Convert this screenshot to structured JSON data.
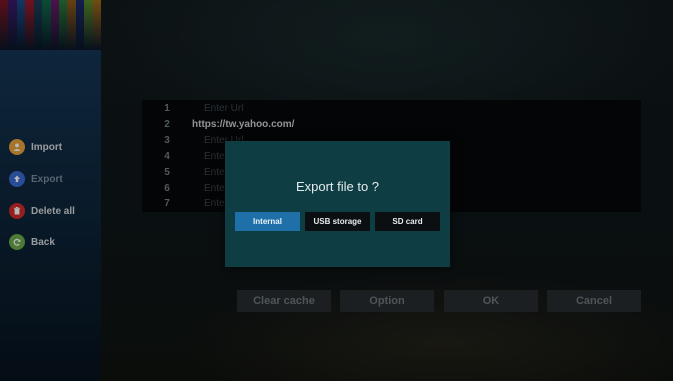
{
  "sidebar": {
    "stripe_colors": [
      "#7a1424",
      "#3a1a6a",
      "#1c4a8a",
      "#9a1a2a",
      "#1a3f5a",
      "#0f6a4a",
      "#6a1a6a",
      "#2a7a3a",
      "#8a5a1a",
      "#1a2a6a",
      "#5a8a2a",
      "#a06a1a"
    ],
    "items": [
      {
        "label": "Import",
        "icon": "person-icon",
        "icon_color": "#e8a23a"
      },
      {
        "label": "Export",
        "icon": "upload-arrow-icon",
        "icon_color": "#3a6ad0"
      },
      {
        "label": "Delete all",
        "icon": "trash-icon",
        "icon_color": "#d22a2a"
      },
      {
        "label": "Back",
        "icon": "back-arrow-icon",
        "icon_color": "#6aa84a"
      }
    ]
  },
  "url_list": {
    "rows": [
      {
        "num": "1",
        "text": "Enter Url"
      },
      {
        "num": "2",
        "text": "https://tw.yahoo.com/"
      },
      {
        "num": "3",
        "text": "Enter Url"
      },
      {
        "num": "4",
        "text": "Enter Url"
      },
      {
        "num": "5",
        "text": "Enter Url"
      },
      {
        "num": "6",
        "text": "Enter Url"
      },
      {
        "num": "7",
        "text": "Enter Url"
      }
    ]
  },
  "bottom_buttons": {
    "clear_cache": "Clear cache",
    "option": "Option",
    "ok": "OK",
    "cancel": "Cancel"
  },
  "dialog": {
    "title": "Export file to ?",
    "options": [
      "Internal",
      "USB storage",
      "SD card"
    ],
    "selected": "Internal",
    "accent_color": "#1f6fa8",
    "background_color": "#0f3d44"
  }
}
